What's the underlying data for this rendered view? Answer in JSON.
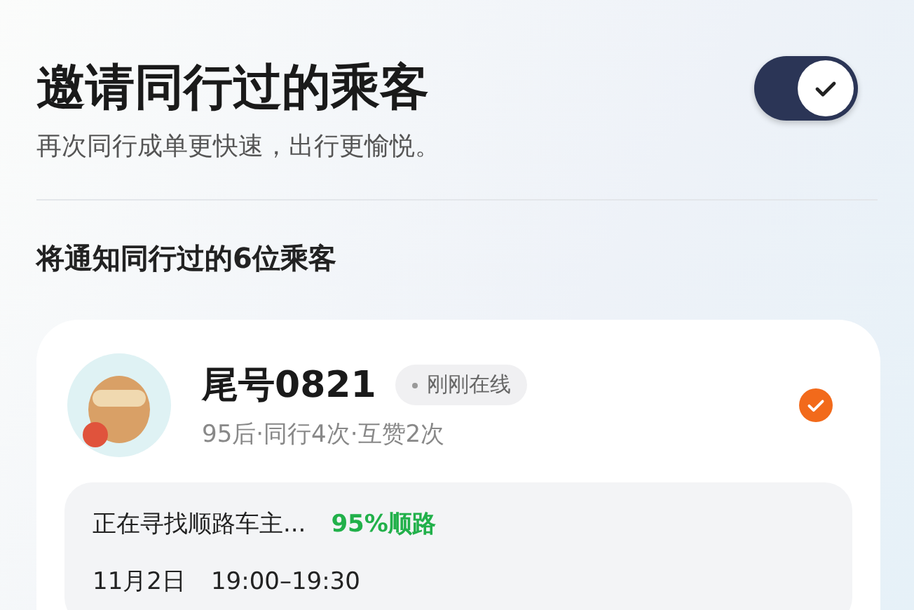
{
  "header": {
    "title": "邀请同行过的乘客",
    "subtitle": "再次同行成单更快速，出行更愉悦。",
    "toggle": {
      "on": true
    }
  },
  "section_title": "将通知同行过的6位乘客",
  "passengers": [
    {
      "name": "尾号0821",
      "status": "刚刚在线",
      "meta": "95后·同行4次·互赞2次",
      "selected": true,
      "trip": {
        "status": "正在寻找顺路车主...",
        "match": "95%顺路",
        "date": "11月2日",
        "time": "19:00–19:30"
      }
    }
  ]
}
